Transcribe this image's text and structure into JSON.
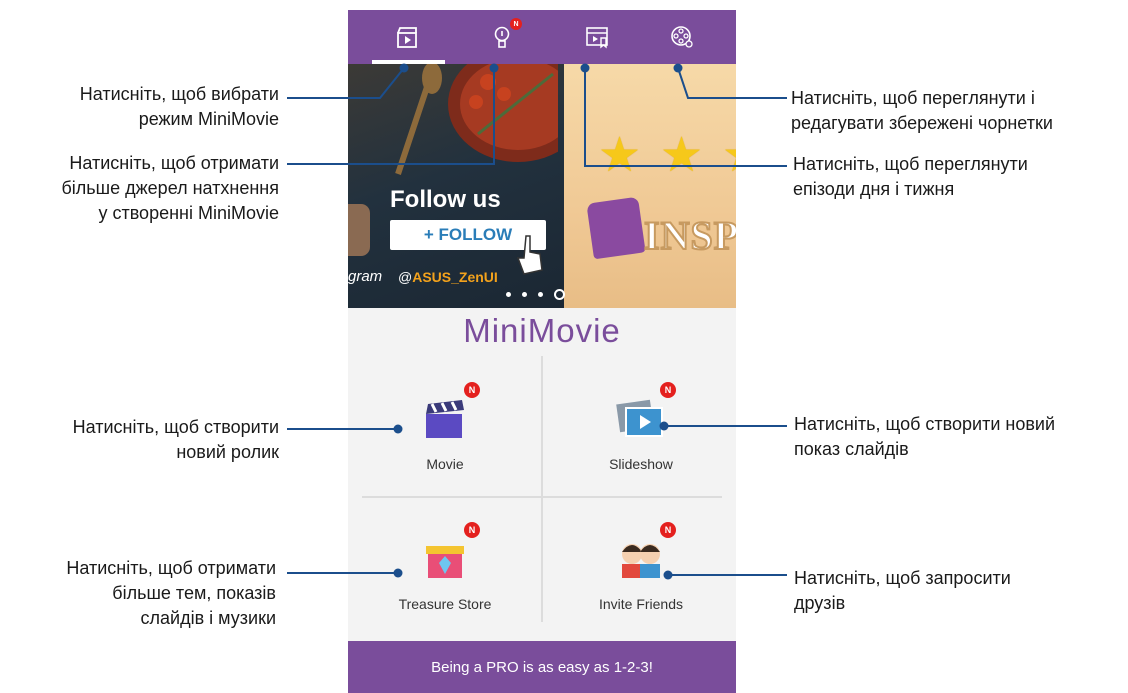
{
  "colors": {
    "accent": "#7a4d9b",
    "badge": "#e4201e",
    "callout_line": "#1b4e8c"
  },
  "tabs": [
    {
      "name": "minimovie-mode",
      "icon": "clapper-icon",
      "active": true
    },
    {
      "name": "inspiration",
      "icon": "lightbulb-icon",
      "badge": "N"
    },
    {
      "name": "episodes",
      "icon": "episodes-icon"
    },
    {
      "name": "drafts",
      "icon": "film-reel-icon"
    }
  ],
  "banner": {
    "follow_title": "Follow us",
    "follow_button": "+ FOLLOW",
    "handle_prefix": "@",
    "handle": "ASUS_ZenUI",
    "gram_text": "gram",
    "right_text": "INSP",
    "page_dots": 4,
    "active_dot": 4
  },
  "logo": "MiniMovie",
  "grid": [
    {
      "label": "Movie",
      "icon": "clapper-icon",
      "badge": "N"
    },
    {
      "label": "Slideshow",
      "icon": "slideshow-icon",
      "badge": "N"
    },
    {
      "label": "Treasure Store",
      "icon": "treasure-icon",
      "badge": "N"
    },
    {
      "label": "Invite Friends",
      "icon": "friends-icon",
      "badge": "N"
    }
  ],
  "footer": "Being a PRO is as easy as 1-2-3!",
  "callouts": {
    "mode": [
      "Натисніть, щоб вибрати",
      "режим MiniMovie"
    ],
    "inspiration": [
      "Натисніть, щоб отримати",
      "більше джерел натхнення",
      "у створенні MiniMovie"
    ],
    "drafts": [
      "Натисніть, щоб переглянути і",
      "редагувати збережені чорнетки"
    ],
    "episodes": [
      "Натисніть, щоб переглянути",
      "епізоди дня і тижня"
    ],
    "movie": [
      "Натисніть, щоб створити",
      "новий ролик"
    ],
    "slideshow": [
      "Натисніть, щоб створити новий",
      "показ слайдів"
    ],
    "treasure": [
      "Натисніть, щоб отримати",
      "більше тем, показів",
      "слайдів і музики"
    ],
    "friends": [
      "Натисніть, щоб запросити",
      "друзів"
    ]
  }
}
